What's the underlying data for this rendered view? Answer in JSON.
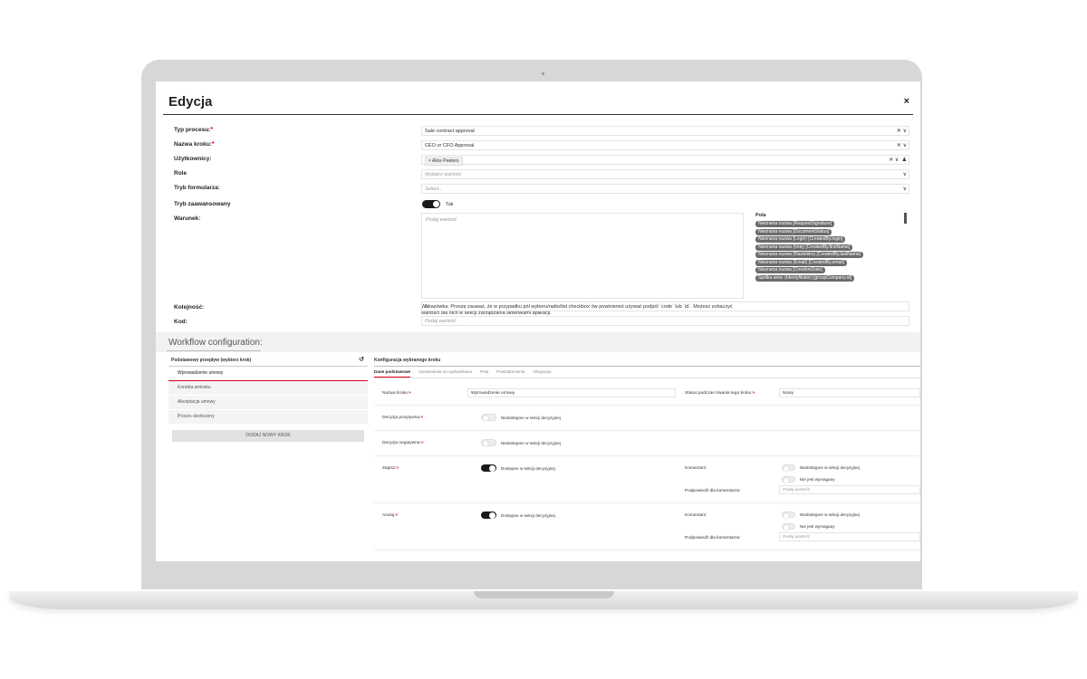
{
  "dialog": {
    "title": "Edycja",
    "close": "×"
  },
  "form": {
    "process_type": {
      "label": "Typ procesu:",
      "value": "Sale contract approval"
    },
    "step_name": {
      "label": "Nazwa kroku:",
      "value": "CEO or CFO Approval"
    },
    "users": {
      "label": "Użytkownicy:",
      "chip": "Alice Peeters"
    },
    "role": {
      "label": "Role",
      "placeholder": "Wybierz wartość"
    },
    "form_mode": {
      "label": "Tryb formularza:",
      "placeholder": "Select..."
    },
    "advanced_mode": {
      "label": "Tryb zaawansowany",
      "value": "Tak"
    },
    "condition": {
      "label": "Warunek:",
      "placeholder": "Podaj wartość"
    },
    "hint": "Wskazówka: Proszę zauważ, że w przypadku pól wyboru/radio/list checkbox`ów powinieneś używać podpól `code` lub `id`. Możesz zobaczyć wartości dla nich w sekcji zarządzania słownikami aplikacji.",
    "order": {
      "label": "Kolejność:",
      "value": "0"
    },
    "code": {
      "label": "Kod:",
      "placeholder": "Podaj wartość"
    }
  },
  "fields_panel": {
    "title": "Pola",
    "tags": [
      "Nieznana nazwa [RequestSignature]",
      "Nieznana nazwa [DocumentStatus]",
      "Nieznana nazwa (Login) [CreatedBy.login]",
      "Nieznana nazwa (Imię) [CreatedBy.firstName]",
      "Nieznana nazwa (Nazwisko) [CreatedBy.lastName]",
      "Nieznana nazwa (Email) [CreatedBy.email]",
      "Nieznana nazwa [CreationDate]",
      "Spółka wew. (Identyfikator) [groupCompany.id]"
    ]
  },
  "workflow": {
    "title": "Workflow configuration:",
    "left": {
      "header": "Podstawowy przepływ (wybierz krok)",
      "reset_icon": "↺",
      "steps": [
        "Wprowadzenie umowy",
        "Korekta wniosku",
        "Akceptacja umowy",
        "Proces skończony"
      ],
      "add_button": "DODAJ NOWY KROK"
    },
    "right": {
      "header": "Konfiguracja wybranego kroku",
      "tabs": [
        "Dane podstawowe",
        "Uprawnienia do wyświetlania",
        "Pola",
        "Powiadomienia",
        "Integracja"
      ],
      "step_name_label": "Nazwa kroku:",
      "step_name_value": "Wprowadzenie umowy",
      "status_label": "Status podczas trwania tego kroku:",
      "status_value": "Nowy",
      "positive_label": "Decyzja pozytywna:",
      "positive_text": "Niedostępne w sekcji decyzyjnej",
      "negative_label": "Decyzja negatywna:",
      "negative_text": "Niedostępne w sekcji decyzyjnej",
      "save_label": "Zapisz:",
      "save_text": "Dostępne w sekcji decyzyjnej",
      "cancel_label": "Anuluj:",
      "cancel_text": "Dostępne w sekcji decyzyjnej",
      "comment_label": "Komentarz:",
      "comment_unavailable": "Niedostępne w sekcji decyzyjnej",
      "comment_not_required": "Nie jest wymagany",
      "hint_label": "Podpowiedź dla komentarza:",
      "hint_placeholder": "Podaj wartość"
    }
  }
}
